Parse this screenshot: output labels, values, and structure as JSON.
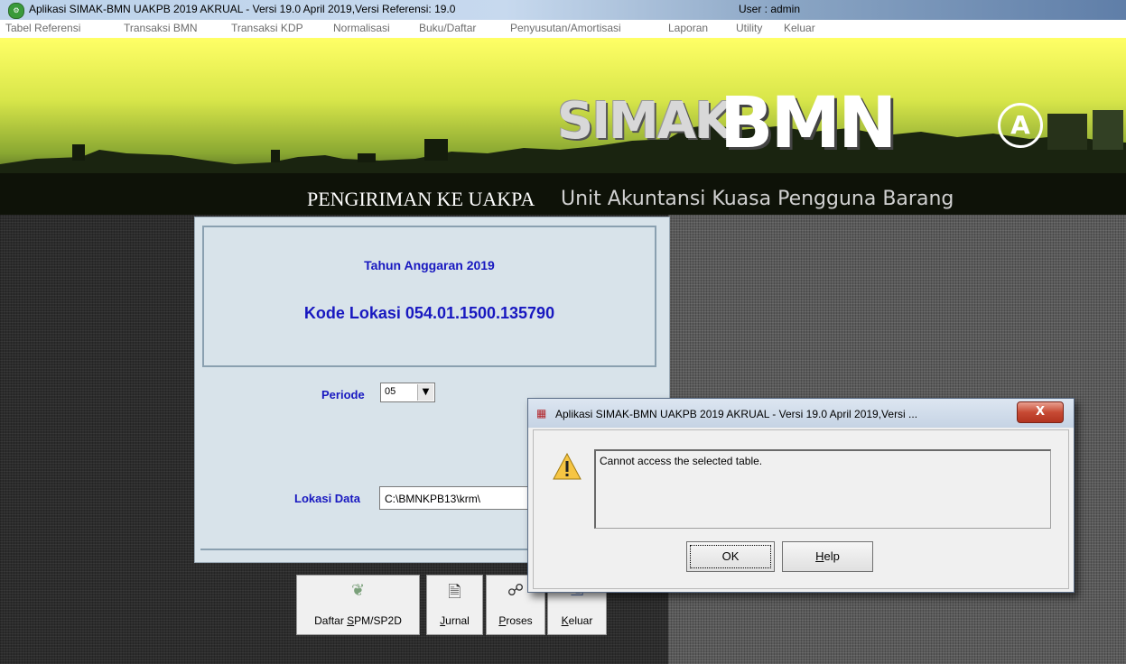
{
  "window": {
    "title": "Aplikasi SIMAK-BMN UAKPB 2019 AKRUAL -  Versi 19.0 April 2019,Versi Referensi: 19.0",
    "user": "User : admin"
  },
  "menu": {
    "items": [
      "Tabel Referensi",
      "Transaksi BMN",
      "Transaksi KDP",
      "Normalisasi",
      "Buku/Daftar",
      "Penyusutan/Amortisasi",
      "Laporan",
      "Utility",
      "Keluar"
    ]
  },
  "banner": {
    "logo_simak": "SIMAK",
    "logo_bmn": "BMN",
    "logo_badge": "A",
    "subtitle": "PENGIRIMAN KE UAKPA",
    "unit": "Unit Akuntansi Kuasa Pengguna Barang"
  },
  "form": {
    "tahun": "Tahun Anggaran 2019",
    "kode_lokasi": "Kode Lokasi  054.01.1500.135790",
    "periode_label": "Periode",
    "periode_value": "05",
    "lokasi_label": "Lokasi Data",
    "lokasi_value": "C:\\BMNKPB13\\krm\\"
  },
  "toolbar": {
    "daftar_pre": "Daftar ",
    "daftar_key": "S",
    "daftar_post": "PM/SP2D",
    "jurnal_key": "J",
    "jurnal_post": "urnal",
    "proses_key": "P",
    "proses_post": "roses",
    "keluar_key": "K",
    "keluar_post": "eluar"
  },
  "dialog": {
    "title": "Aplikasi SIMAK-BMN UAKPB 2019 AKRUAL -  Versi 19.0 April 2019,Versi ...",
    "message": "Cannot access the selected table.",
    "ok_label": "OK",
    "help_key": "H",
    "help_post": "elp",
    "close_glyph": "X"
  },
  "icons": {
    "title_icon": "app-icon",
    "dialog_icon": "app-icon",
    "warning": "warning-icon",
    "daftar": "document-icon",
    "jurnal": "journal-icon",
    "proses": "process-icon",
    "keluar": "exit-icon"
  },
  "colors": {
    "label_blue": "#1818c0",
    "panel_bg": "#d8e3ea",
    "dialog_bg": "#f0f0f0",
    "close_red": "#c74a34"
  }
}
